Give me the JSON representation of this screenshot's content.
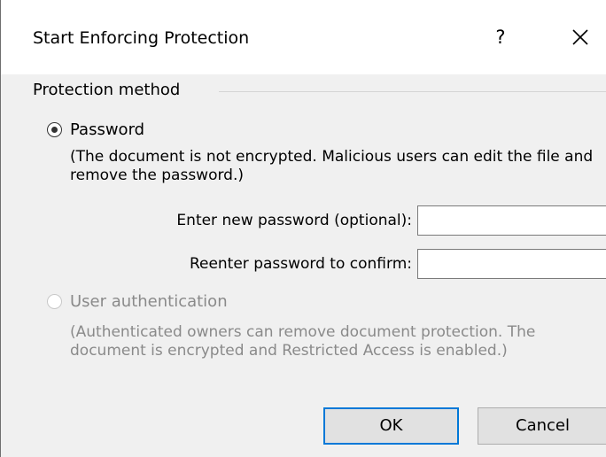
{
  "dialog": {
    "title": "Start Enforcing Protection",
    "help_label": "?",
    "close_icon": "close-icon"
  },
  "protection": {
    "group_label": "Protection method",
    "password_option": {
      "label": "Password",
      "selected": true,
      "description": "(The document is not encrypted. Malicious users can edit the file and remove the password.)",
      "new_password_label": "Enter new password (optional):",
      "new_password_value": "",
      "confirm_password_label": "Reenter password to confirm:",
      "confirm_password_value": ""
    },
    "user_auth_option": {
      "label": "User authentication",
      "selected": false,
      "enabled": false,
      "description": "(Authenticated owners can remove document protection. The document is encrypted and Restricted Access is enabled.)"
    }
  },
  "buttons": {
    "ok_label": "OK",
    "cancel_label": "Cancel"
  }
}
